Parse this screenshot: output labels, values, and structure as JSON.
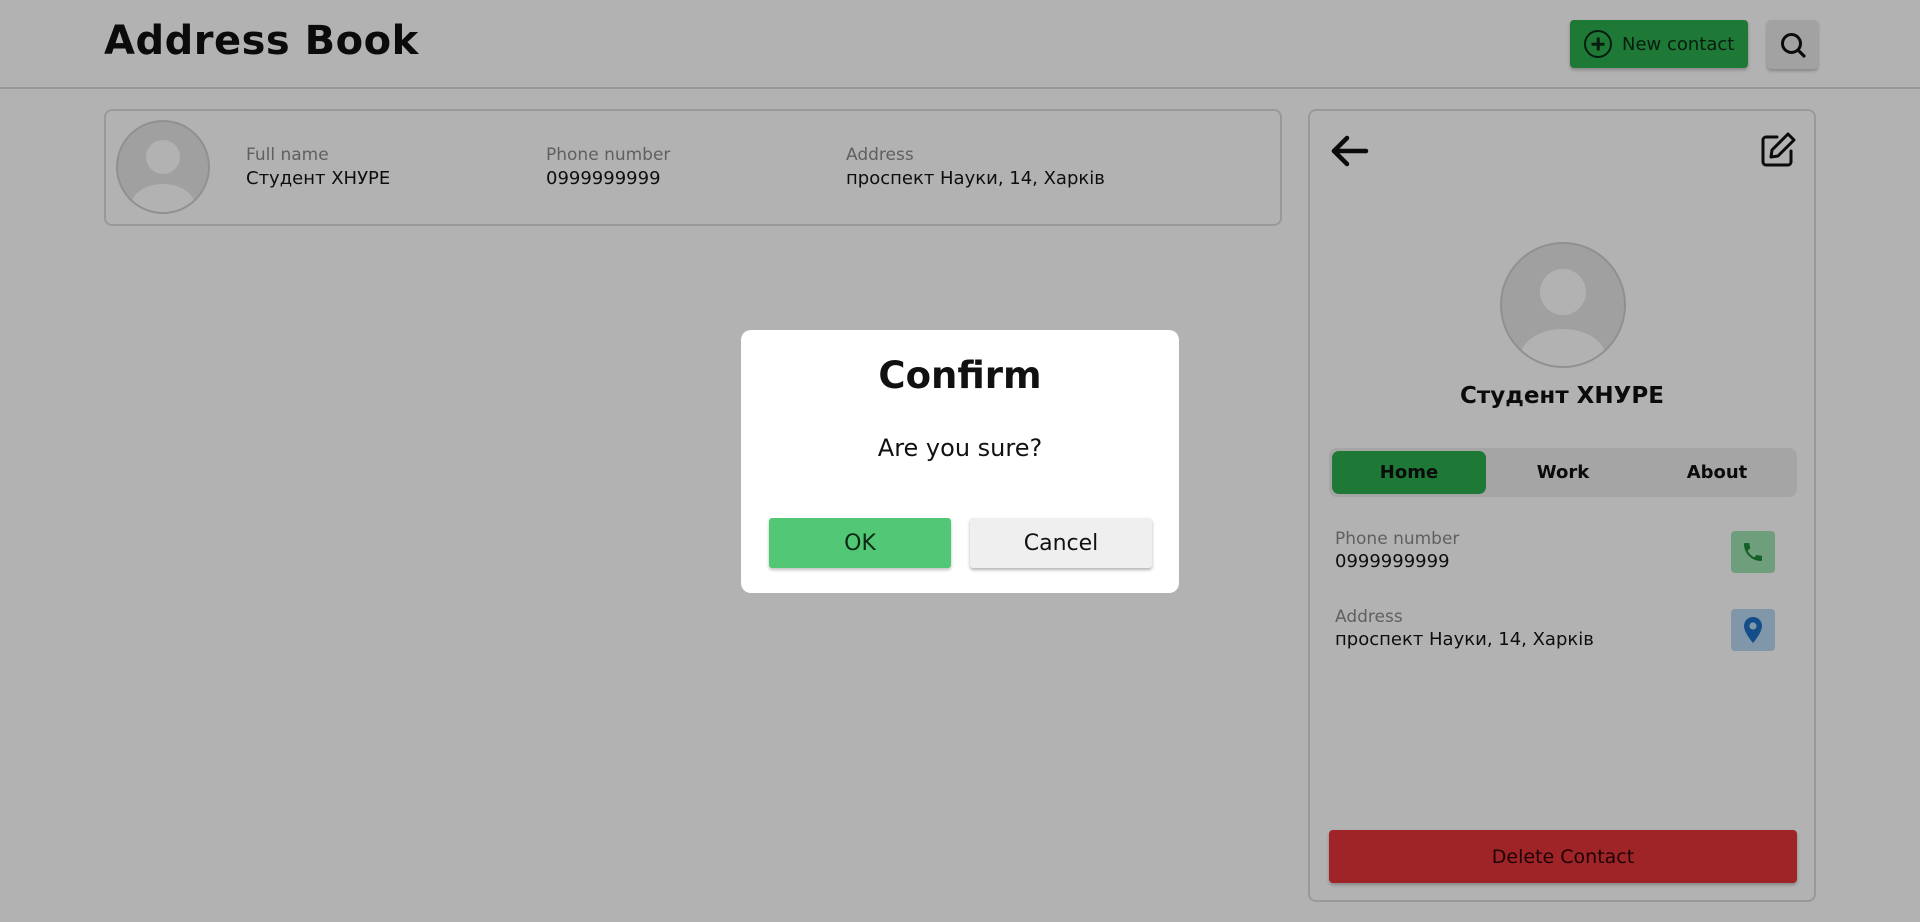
{
  "header": {
    "title": "Address Book",
    "new_contact_label": "New contact",
    "icons": {
      "new_contact": "plus-circle-icon",
      "search": "search-icon"
    }
  },
  "contact_list": [
    {
      "avatar": "avatar-placeholder-icon",
      "full_name_label": "Full name",
      "full_name": "Студент ХНУРЕ",
      "phone_label": "Phone number",
      "phone": "0999999999",
      "address_label": "Address",
      "address": "проспект Науки, 14, Харків"
    }
  ],
  "details": {
    "name": "Студент ХНУРЕ",
    "tabs": [
      {
        "label": "Home",
        "active": true
      },
      {
        "label": "Work",
        "active": false
      },
      {
        "label": "About",
        "active": false
      }
    ],
    "phone_label": "Phone number",
    "phone": "0999999999",
    "address_label": "Address",
    "address": "проспект Науки, 14, Харків",
    "delete_label": "Delete Contact",
    "icons": {
      "back": "arrow-left-icon",
      "edit": "edit-icon",
      "phone": "phone-icon",
      "map": "map-pin-icon"
    }
  },
  "dialog": {
    "title": "Confirm",
    "message": "Are you sure?",
    "ok_label": "OK",
    "cancel_label": "Cancel"
  },
  "colors": {
    "accent_green": "#2bad4e",
    "ok_green": "#52c877",
    "danger_red": "#e3343a",
    "phone_box": "#9fe2b3",
    "map_box": "#b6d8f3",
    "overlay": "rgba(0,0,0,0.30)"
  }
}
